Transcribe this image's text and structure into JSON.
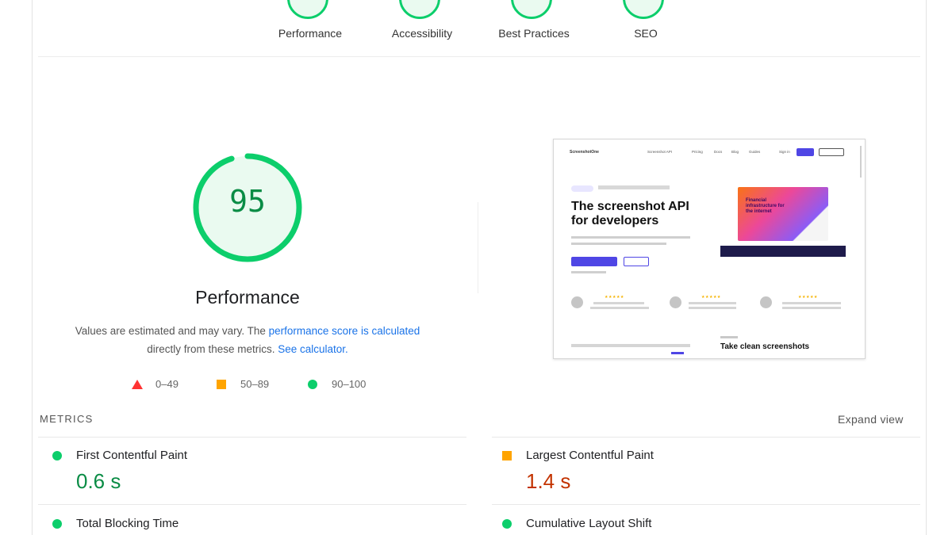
{
  "categories": [
    {
      "label": "Performance"
    },
    {
      "label": "Accessibility"
    },
    {
      "label": "Best Practices"
    },
    {
      "label": "SEO"
    }
  ],
  "gauge": {
    "score": "95",
    "fraction": 0.95,
    "title": "Performance",
    "color": "#0cce6b"
  },
  "description": {
    "text1": "Values are estimated and may vary. The ",
    "link1": "performance score is calculated",
    "text2": "directly from these metrics. ",
    "link2": "See calculator."
  },
  "legend": [
    {
      "label": "0–49",
      "shape": "triangle",
      "color": "#ff3333"
    },
    {
      "label": "50–89",
      "shape": "square",
      "color": "#ffa400"
    },
    {
      "label": "90–100",
      "shape": "circle",
      "color": "#0cce6b"
    }
  ],
  "screenshot": {
    "logo": "ScreenshotOne",
    "nav": [
      "Screenshot API",
      "Pricing",
      "Docs",
      "Blog",
      "Guides",
      "Sign in"
    ],
    "headline_line1": "The screenshot API",
    "headline_line2": "for developers",
    "hero_text": "Financial infrastructure for the internet",
    "stars": "★★★★★",
    "section_title": "Take clean screenshots"
  },
  "metrics": {
    "header": "METRICS",
    "expand": "Expand view",
    "items": [
      {
        "name": "First Contentful Paint",
        "value": "0.6 s",
        "status": "good"
      },
      {
        "name": "Largest Contentful Paint",
        "value": "1.4 s",
        "status": "average"
      },
      {
        "name": "Total Blocking Time",
        "status": "good"
      },
      {
        "name": "Cumulative Layout Shift",
        "status": "good"
      }
    ]
  }
}
